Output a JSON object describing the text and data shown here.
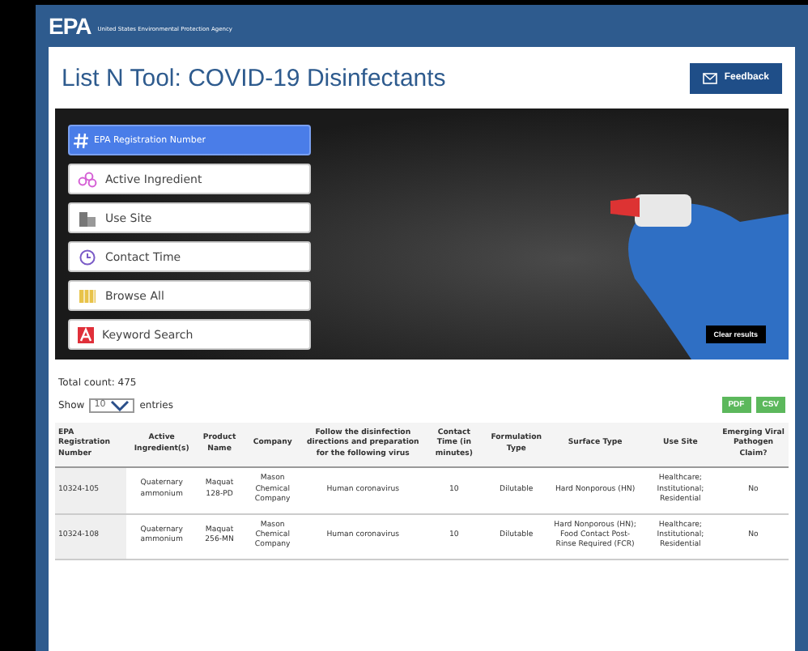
{
  "header": {
    "logo": "EPA",
    "agency": "United States Environmental Protection Agency"
  },
  "page": {
    "title": "List N Tool: COVID-19 Disinfectants",
    "feedback_button": "Feedback"
  },
  "search_options": [
    {
      "label": "EPA Registration Number",
      "kind": "hash",
      "selected": true
    },
    {
      "label": "Active Ingredient",
      "kind": "molecule",
      "selected": false
    },
    {
      "label": "Use Site",
      "kind": "building",
      "selected": false
    },
    {
      "label": "Contact Time",
      "kind": "clock",
      "selected": false
    },
    {
      "label": "Browse All",
      "kind": "grid",
      "selected": false
    },
    {
      "label": "Keyword Search",
      "kind": "letter",
      "selected": false
    }
  ],
  "clear_button": "Clear results",
  "total_count": "Total count: 475",
  "length_control": {
    "prefix": "Show",
    "value": "10",
    "suffix": "entries"
  },
  "export_buttons": [
    "PDF",
    "CSV"
  ],
  "table": {
    "columns": [
      "EPA Registration Number",
      "Active Ingredient(s)",
      "Product Name",
      "Company",
      "Follow the disinfection directions and preparation for the following virus",
      "Contact Time (in minutes)",
      "Formulation Type",
      "Surface Type",
      "Use Site",
      "Emerging Viral Pathogen Claim?"
    ],
    "rows": [
      [
        "10324-105",
        "Quaternary ammonium",
        "Maquat 128-PD",
        "Mason Chemical Company",
        "Human coronavirus",
        "10",
        "Dilutable",
        "Hard Nonporous (HN)",
        "Healthcare; Institutional; Residential",
        "No"
      ],
      [
        "10324-108",
        "Quaternary ammonium",
        "Maquat 256-MN",
        "Mason Chemical Company",
        "Human coronavirus",
        "10",
        "Dilutable",
        "Hard Nonporous (HN); Food Contact Post-Rinse Required (FCR)",
        "Healthcare; Institutional; Residential",
        "No"
      ]
    ]
  }
}
